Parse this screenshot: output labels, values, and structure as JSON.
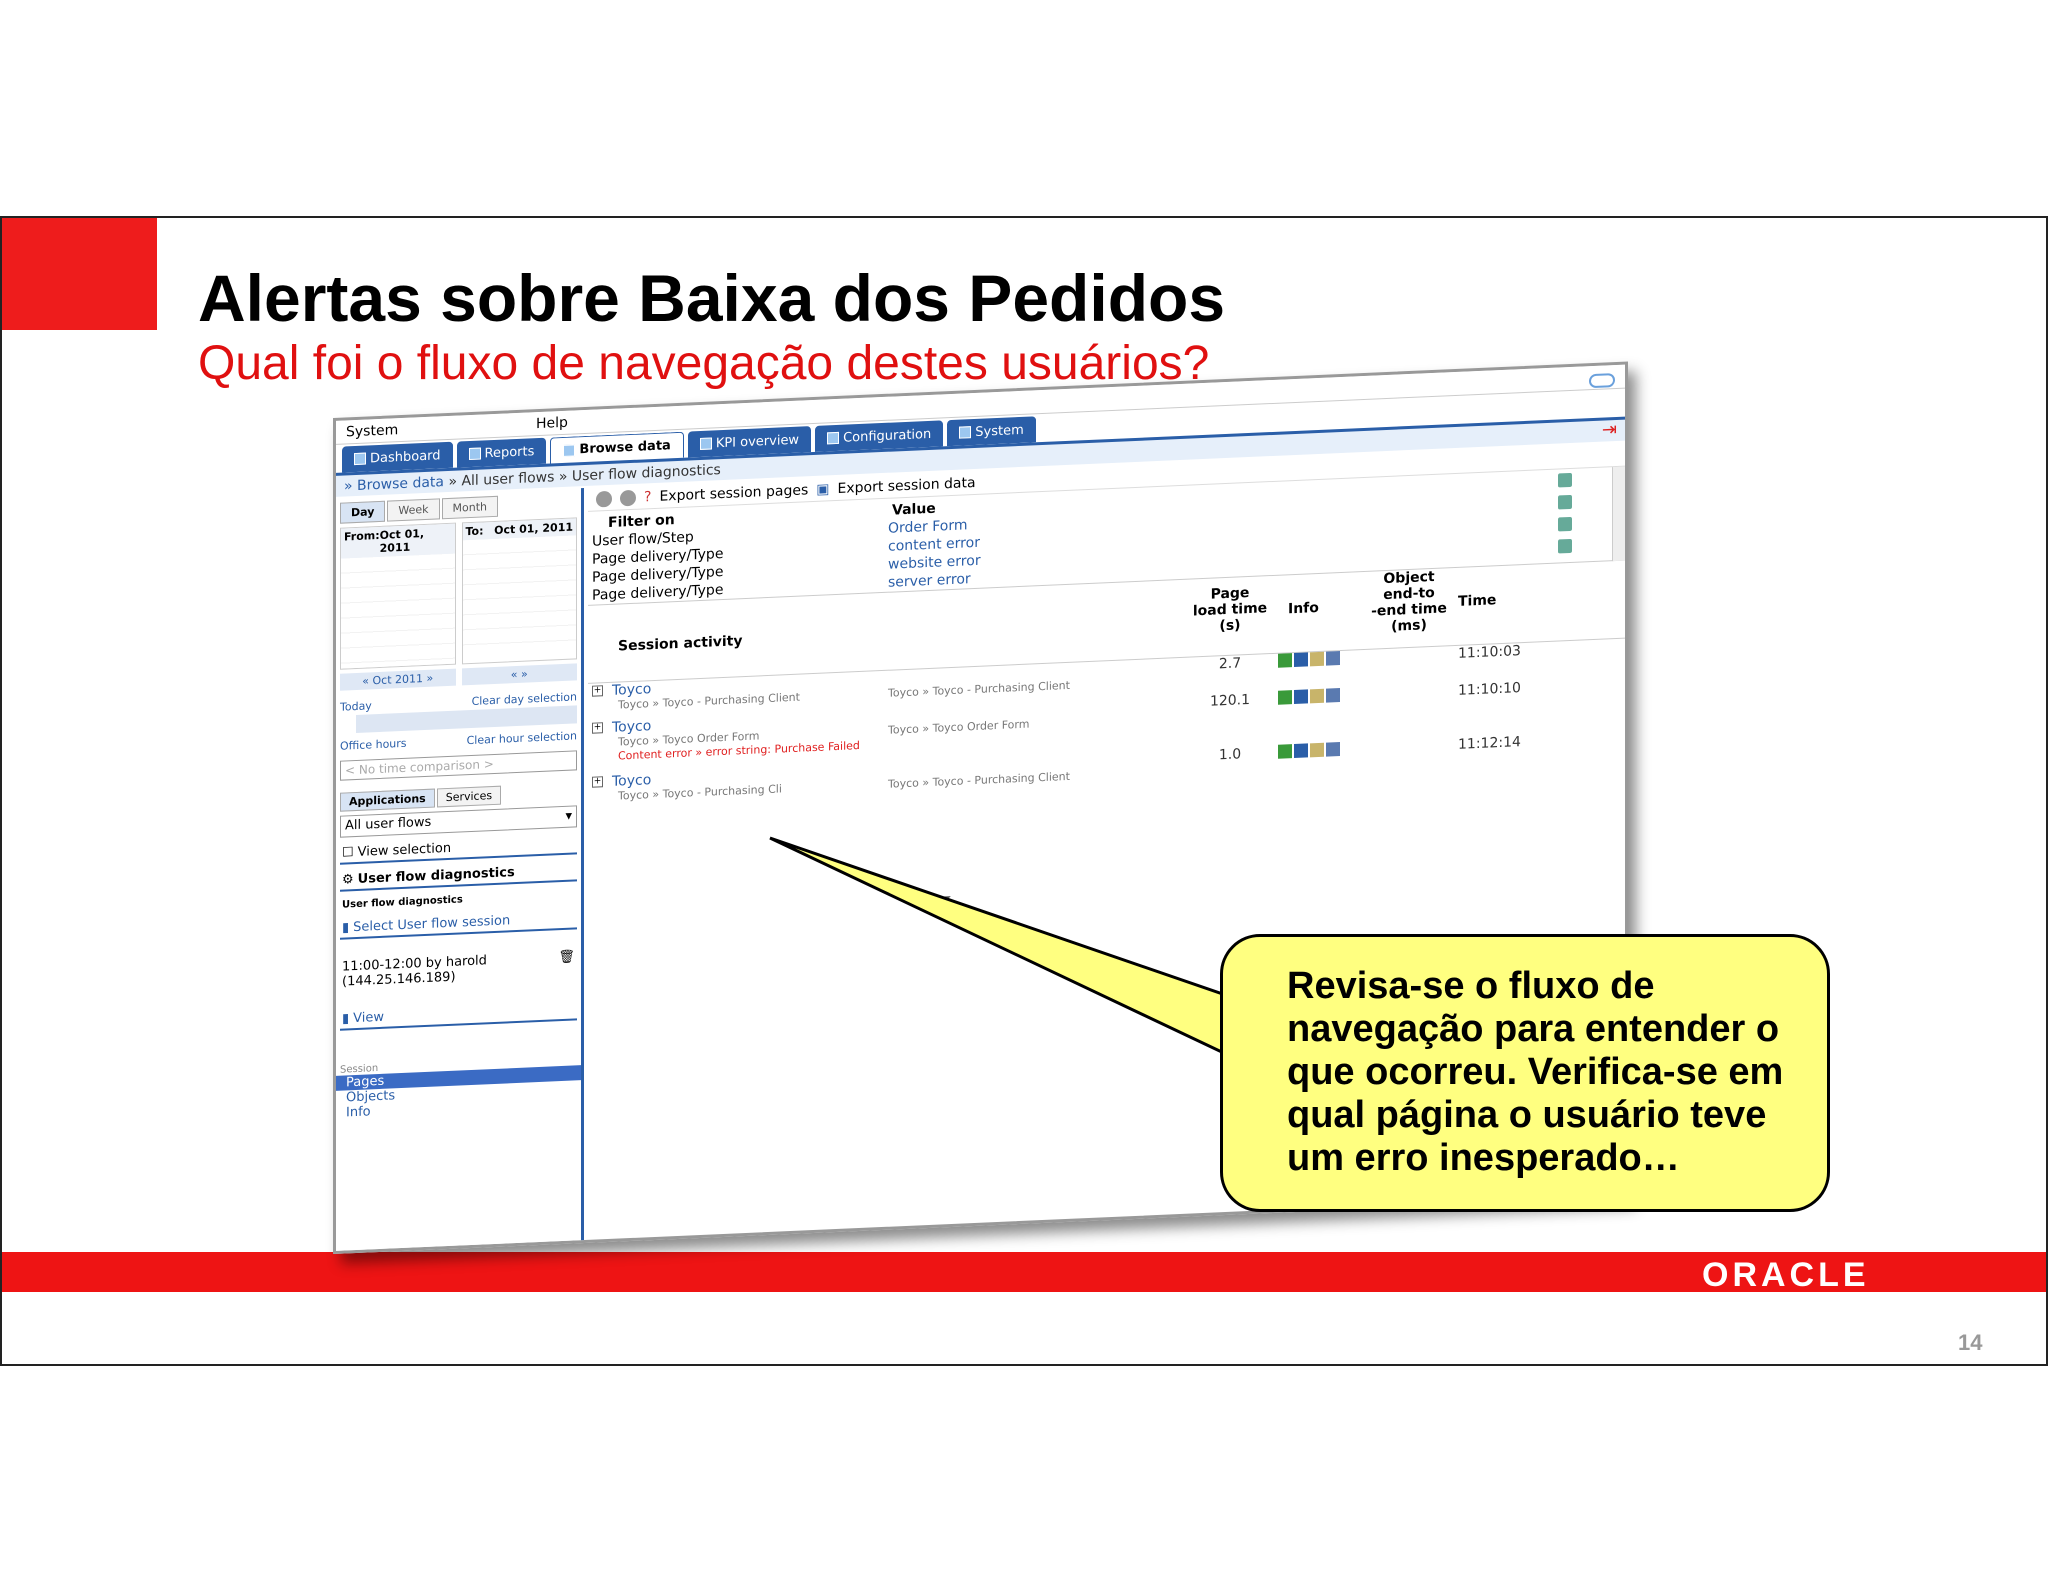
{
  "slide": {
    "title": "Alertas sobre Baixa dos Pedidos",
    "subtitle": "Qual foi o fluxo de navegação destes usuários?",
    "brand": "ORACLE",
    "page_number": "14",
    "callout": "Revisa-se o fluxo de navegação para entender o que ocorreu. Verifica-se em qual página o usuário teve um erro inesperado…",
    "colors": {
      "brand_red": "#ee1c1c",
      "callout_fill": "#ffff80",
      "app_blue": "#2a5ea8"
    }
  },
  "app": {
    "menu": [
      "System",
      "Help"
    ],
    "tabs": [
      "Dashboard",
      "Reports",
      "Browse data",
      "KPI overview",
      "Configuration",
      "System"
    ],
    "active_tab": "Browse data",
    "breadcrumb": [
      "» Browse data",
      "» All user flows",
      "» User flow diagnostics"
    ],
    "left": {
      "date_tabs": [
        "Day",
        "Week",
        "Month"
      ],
      "from_label": "From:",
      "from_date": "Oct 01, 2011",
      "to_label": "To:",
      "to_date": "Oct 01, 2011",
      "cal_nav_1": "« Oct 2011 »",
      "today": "Today",
      "clear_day": "Clear day selection",
      "office_hours": "Office hours",
      "clear_hour": "Clear hour selection",
      "time_comparison_placeholder": "< No time comparison >",
      "app_tabs": [
        "Applications",
        "Services"
      ],
      "flows_select": "All user flows",
      "view_selection": "View selection",
      "user_flow_diagnostics": "User flow diagnostics",
      "diag_sub": "User flow diagnostics",
      "select_session": "Select User flow session",
      "session_line1": "11:00-12:00 by harold",
      "session_line2": "(144.25.146.189)",
      "view": "View",
      "session_label": "Session",
      "session_opts": [
        "Pages",
        "Objects",
        "Info"
      ]
    },
    "toolbar": {
      "export_pages": "Export session pages",
      "export_data": "Export session data"
    },
    "filter": {
      "header_filter": "Filter on",
      "header_value": "Value",
      "rows": [
        {
          "key": "User flow/Step",
          "value": "Order Form"
        },
        {
          "key": "Page delivery/Type",
          "value": "content error"
        },
        {
          "key": "Page delivery/Type",
          "value": "website error"
        },
        {
          "key": "Page delivery/Type",
          "value": "server error"
        }
      ]
    },
    "grid": {
      "headers": {
        "session": "Session activity",
        "load_1": "Page",
        "load_2": "load time",
        "load_3": "(s)",
        "info": "Info",
        "obj_1": "Object",
        "obj_2": "end-to",
        "obj_3": "-end time",
        "obj_4": "(ms)",
        "time": "Time"
      },
      "rows": [
        {
          "title": "Toyco",
          "sub": "Toyco » Toyco - Purchasing Client",
          "sub2": "Toyco » Toyco - Purchasing Client",
          "error": "",
          "load": "2.7",
          "time": "11:10:03"
        },
        {
          "title": "Toyco",
          "sub": "Toyco » Toyco Order Form",
          "sub2": "Toyco » Toyco Order Form",
          "error": "Content error » error string: Purchase Failed",
          "load": "120.1",
          "time": "11:10:10"
        },
        {
          "title": "Toyco",
          "sub": "Toyco » Toyco - Purchasing Cli",
          "sub2": "Toyco » Toyco - Purchasing Client",
          "error": "",
          "load": "1.0",
          "time": "11:12:14"
        }
      ]
    }
  }
}
